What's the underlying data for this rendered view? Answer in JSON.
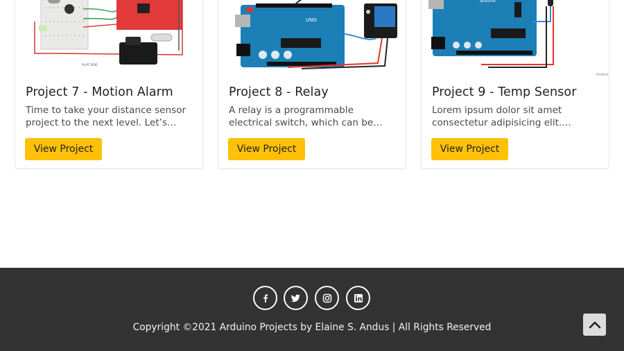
{
  "projects": [
    {
      "title": "Project 7 - Motion Alarm",
      "description": "Time to take your distance sensor project to the next level. Let’s…",
      "button_label": "View Project",
      "thumb_caption": "PLAT SIDE"
    },
    {
      "title": "Project 8 - Relay",
      "description": "A relay is a programmable electrical switch, which can be…",
      "button_label": "View Project",
      "thumb_caption": "UNO"
    },
    {
      "title": "Project 9 - Temp Sensor",
      "description": "Lorem ipsum dolor sit amet consectetur adipisicing elit.…",
      "button_label": "View Project",
      "thumb_caption": "fritzing"
    }
  ],
  "footer": {
    "social_icons": [
      "facebook-icon",
      "twitter-icon",
      "instagram-icon",
      "linkedin-icon"
    ],
    "copyright": "Copyright ©2021 Arduino Projects by Elaine S. Andus | All Rights Reserved"
  },
  "scroll_top": {
    "icon": "chevron-up-icon"
  },
  "colors": {
    "accent": "#fec107",
    "footer_bg": "#333333",
    "board_blue": "#1c7fb6",
    "board_red": "#e8322d"
  }
}
